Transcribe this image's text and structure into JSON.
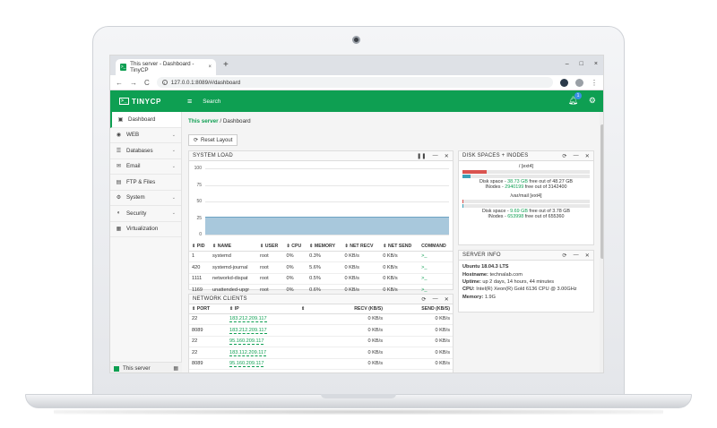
{
  "browser": {
    "tab_title": "This server - Dashboard - TinyCP",
    "favicon_glyph": ">_",
    "new_tab_glyph": "+",
    "close_glyph": "×",
    "url": "127.0.0.1:8089/#/dashboard",
    "win_min": "–",
    "win_max": "□",
    "win_close": "×",
    "back": "←",
    "forward": "→",
    "reload": "C",
    "menu": "⋮"
  },
  "app": {
    "logo_text": "TINYCP",
    "logo_glyph": ">_",
    "search_label": "Search",
    "notification_count": "1",
    "accent_color": "#0e9f52"
  },
  "sidebar": {
    "items": [
      {
        "label": "Dashboard",
        "icon": "dashboard-icon",
        "glyph": "▣"
      },
      {
        "label": "WEB",
        "icon": "globe-icon",
        "glyph": "◉"
      },
      {
        "label": "Databases",
        "icon": "database-icon",
        "glyph": "☰"
      },
      {
        "label": "Email",
        "icon": "envelope-icon",
        "glyph": "✉"
      },
      {
        "label": "FTP & Files",
        "icon": "folder-icon",
        "glyph": "▤"
      },
      {
        "label": "System",
        "icon": "cog-icon",
        "glyph": "⚙"
      },
      {
        "label": "Security",
        "icon": "shield-icon",
        "glyph": "◐"
      },
      {
        "label": "Virtualization",
        "icon": "grid-icon",
        "glyph": "▦"
      }
    ],
    "chevron": "⌄",
    "footer_label": "This server",
    "footer_icon": "▦"
  },
  "breadcrumb": {
    "link": "This server",
    "separator": "/",
    "current": "Dashboard"
  },
  "reset_button": {
    "icon": "⟳",
    "label": "Reset Layout"
  },
  "system_load": {
    "title": "SYSTEM LOAD",
    "tools": {
      "pause": "❚❚",
      "minimize": "—",
      "close": "✕"
    },
    "chart_data": {
      "type": "area",
      "ylim": [
        0,
        100
      ],
      "yticks": [
        0,
        25,
        50,
        75,
        100
      ],
      "values": [
        27,
        27,
        27,
        27,
        27,
        27,
        27,
        27,
        27,
        27,
        27,
        27,
        27,
        27,
        27,
        27,
        27,
        27,
        27,
        27
      ],
      "color": "#a8c8dc"
    },
    "columns": [
      "⇕ PID",
      "⇕ NAME",
      "⇕ USER",
      "⇕ CPU",
      "⇕ MEMORY",
      "⇕ NET RECV",
      "⇕ NET SEND",
      "COMMAND"
    ],
    "rows": [
      {
        "pid": "1",
        "name": "systemd",
        "user": "root",
        "cpu": "0%",
        "memory": "0.3%",
        "recv": "0 KB/s",
        "send": "0 KB/s",
        "cmd": ">_"
      },
      {
        "pid": "420",
        "name": "systemd-journal",
        "user": "root",
        "cpu": "0%",
        "memory": "5.6%",
        "recv": "0 KB/s",
        "send": "0 KB/s",
        "cmd": ">_"
      },
      {
        "pid": "1111",
        "name": "networkd-dispat",
        "user": "root",
        "cpu": "0%",
        "memory": "0.5%",
        "recv": "0 KB/s",
        "send": "0 KB/s",
        "cmd": ">_"
      },
      {
        "pid": "1169",
        "name": "unattended-upgr",
        "user": "root",
        "cpu": "0%",
        "memory": "0.6%",
        "recv": "0 KB/s",
        "send": "0 KB/s",
        "cmd": ">_"
      }
    ]
  },
  "disk_spaces": {
    "title": "DISK SPACES + INODES",
    "tools": {
      "refresh": "⟳",
      "minimize": "—",
      "close": "✕"
    },
    "mounts": [
      {
        "name": "/ [ext4]",
        "space_fill": 0.19,
        "space_color": "#d9534f",
        "inode_fill": 0.06,
        "inode_color": "#3aa0b8",
        "space_prefix": "Disk space - ",
        "space_free": "38.73 GB",
        "space_suffix": " free out of 48.27 GB",
        "inode_prefix": "INodes - ",
        "inode_free": "2940199",
        "inode_suffix": " free out of 3142400"
      },
      {
        "name": "/var/mail [ext4]",
        "space_fill": 0.01,
        "space_color": "#d9534f",
        "inode_fill": 0.01,
        "inode_color": "#3aa0b8",
        "space_prefix": "Disk space - ",
        "space_free": "9.69 GB",
        "space_suffix": " free out of 3.78 GB",
        "inode_prefix": "INodes - ",
        "inode_free": "653998",
        "inode_suffix": " free out of 655360"
      }
    ]
  },
  "server_info": {
    "title": "SERVER INFO",
    "tools": {
      "refresh": "⟳",
      "minimize": "—",
      "close": "✕"
    },
    "os": "Ubuntu 18.04.3 LTS",
    "hostname_label": "Hostname:",
    "hostname": "technalab.com",
    "uptime_label": "Uptime:",
    "uptime": "up 2 days, 14 hours, 44 minutes",
    "cpu_label": "CPU:",
    "cpu": "Intel(R) Xeon(R) Gold 6136 CPU @ 3.00GHz",
    "memory_label": "Memory:",
    "memory": "1.9G"
  },
  "network_clients": {
    "title": "NETWORK CLIENTS",
    "tools": {
      "refresh": "⟳",
      "minimize": "—",
      "close": "✕"
    },
    "columns": [
      "⇕ PORT",
      "⇕ IP",
      "⇕",
      "RECV (KB/S)",
      "SEND (KB/S)"
    ],
    "rows": [
      {
        "port": "22",
        "ip": "183.212.209.117",
        "recv": "0 KB/s",
        "send": "0 KB/s"
      },
      {
        "port": "8089",
        "ip": "183.212.209.117",
        "recv": "0 KB/s",
        "send": "0 KB/s"
      },
      {
        "port": "22",
        "ip": "95.160.209.117",
        "recv": "0 KB/s",
        "send": "0 KB/s"
      },
      {
        "port": "22",
        "ip": "183.112.209.117",
        "recv": "0 KB/s",
        "send": "0 KB/s"
      },
      {
        "port": "8089",
        "ip": "95.160.209.117",
        "recv": "0 KB/s",
        "send": "0 KB/s"
      }
    ]
  }
}
